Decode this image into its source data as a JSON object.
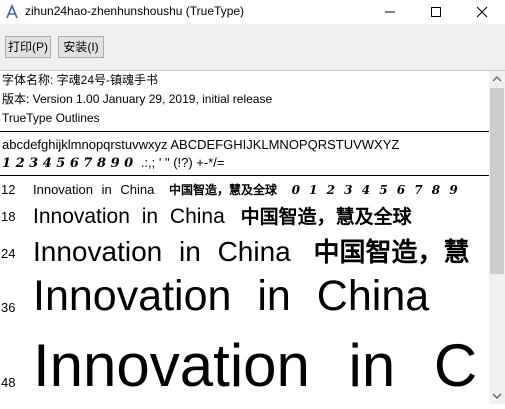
{
  "window": {
    "title": "zihun24hao-zhenhunshoushu (TrueType)",
    "icon": "font-file-icon",
    "controls": [
      "minimize-icon",
      "maximize-icon",
      "close-icon"
    ]
  },
  "toolbar": {
    "print_label": "打印(P)",
    "install_label": "安装(I)"
  },
  "font_info": {
    "name_line": "字体名称: 字魂24号-镇魂手书",
    "version_line": "版本: Version 1.00 January 29, 2019, initial release",
    "type_line": "TrueType Outlines"
  },
  "character_sample": {
    "letters": "abcdefghijklmnopqrstuvwxyz  ABCDEFGHIJKLMNOPQRSTUVWXYZ",
    "digits": "1 2 3 4 5 6 7 8 9 0",
    "punct": ".:,; ' \" (!?) +-*/="
  },
  "size_rows": [
    {
      "size": "12",
      "latin": "Innovation in China",
      "cjk": "中国智造，慧及全球",
      "digits": "0 1 2 3 4 5 6 7 8 9"
    },
    {
      "size": "18",
      "latin": "Innovation in China",
      "cjk": "中国智造，慧及全球"
    },
    {
      "size": "24",
      "latin": "Innovation in China",
      "cjk": "中国智造，慧"
    },
    {
      "size": "36",
      "latin": "Innovation in China"
    },
    {
      "size": "48",
      "latin": "Innovation in C"
    }
  ]
}
